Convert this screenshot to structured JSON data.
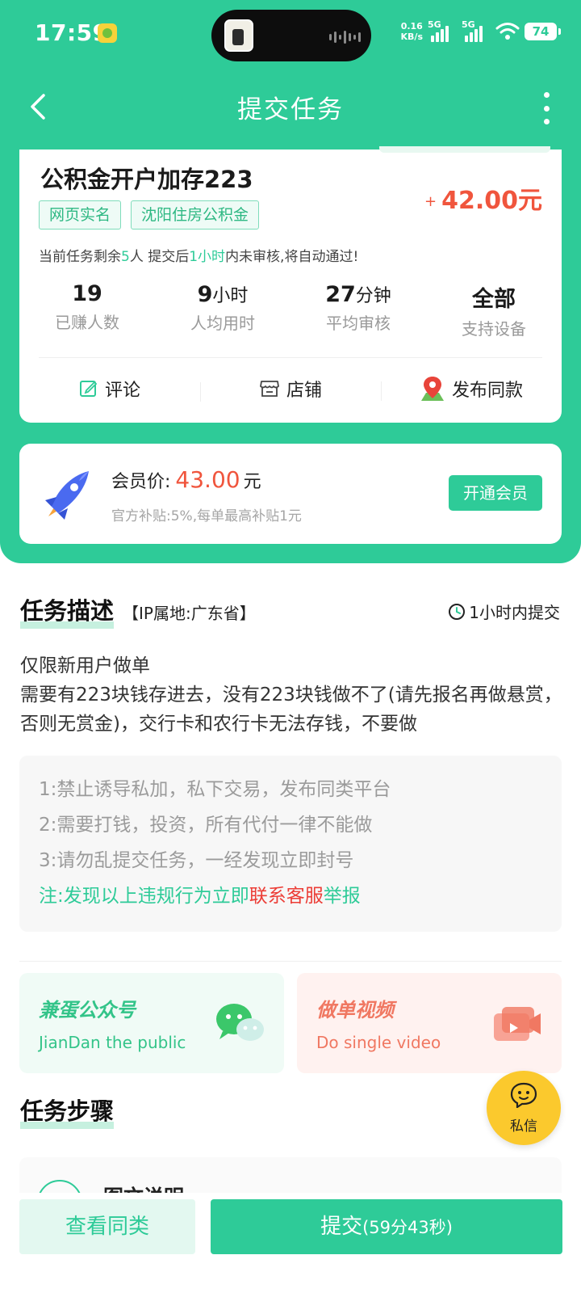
{
  "status_bar": {
    "time": "17:59",
    "net_speed_value": "0.16",
    "net_speed_unit": "KB/s",
    "sim1_label": "5G",
    "sim2_label": "5G",
    "wifi_badge": "6",
    "battery": "74"
  },
  "nav": {
    "title": "提交任务"
  },
  "task": {
    "title": "公积金开户加存223",
    "reward_prefix": "+",
    "reward": "42.00元",
    "tags": [
      "网页实名",
      "沈阳住房公积金"
    ],
    "notice_pre": "当前任务剩余",
    "notice_count": "5",
    "notice_mid": "人  提交后",
    "notice_time": "1小时",
    "notice_post": "内未审核,将自动通过!",
    "stats": [
      {
        "value": "19",
        "unit": "",
        "label": "已赚人数"
      },
      {
        "value": "9",
        "unit": "小时",
        "label": "人均用时"
      },
      {
        "value": "27",
        "unit": "分钟",
        "label": "平均审核"
      },
      {
        "value": "全部",
        "unit": "",
        "label": "支持设备"
      }
    ],
    "actions": [
      {
        "label": "评论",
        "icon": "edit-icon"
      },
      {
        "label": "店铺",
        "icon": "store-icon"
      },
      {
        "label": "发布同款",
        "icon": "location-pin-icon"
      }
    ]
  },
  "member": {
    "label": "会员价:",
    "price": "43.00",
    "currency": "元",
    "subtitle": "官方补贴:5%,每单最高补贴1元",
    "button": "开通会员"
  },
  "description": {
    "title": "任务描述",
    "ip": "【IP属地:广东省】",
    "deadline": "1小时内提交",
    "lines": [
      "仅限新用户做单",
      "需要有223块钱存进去，没有223块钱做不了(请先报名再做悬赏，否则无赏金)，交行卡和农行卡无法存钱，不要做"
    ],
    "rules": [
      "1:禁止诱导私加，私下交易，发布同类平台",
      "2:需要打钱，投资，所有代付一律不能做",
      "3:请勿乱提交任务，一经发现立即封号"
    ],
    "note_pre": "注:发现以上违规行为立即",
    "note_link": "联系客服",
    "note_post": "举报"
  },
  "promos": [
    {
      "title": "兼蛋公众号",
      "subtitle": "JianDan the public",
      "icon": "wechat-icon"
    },
    {
      "title": "做单视频",
      "subtitle": "Do single video",
      "icon": "video-icon"
    }
  ],
  "steps": {
    "title": "任务步骤",
    "first_item": "图文说明"
  },
  "fab": {
    "label": "私信"
  },
  "bottom": {
    "similar": "查看同类",
    "submit": "提交",
    "countdown": "(59分43秒)"
  },
  "colors": {
    "primary": "#2ecb98",
    "price_red": "#f0553d",
    "fab_yellow": "#fbc92d"
  }
}
